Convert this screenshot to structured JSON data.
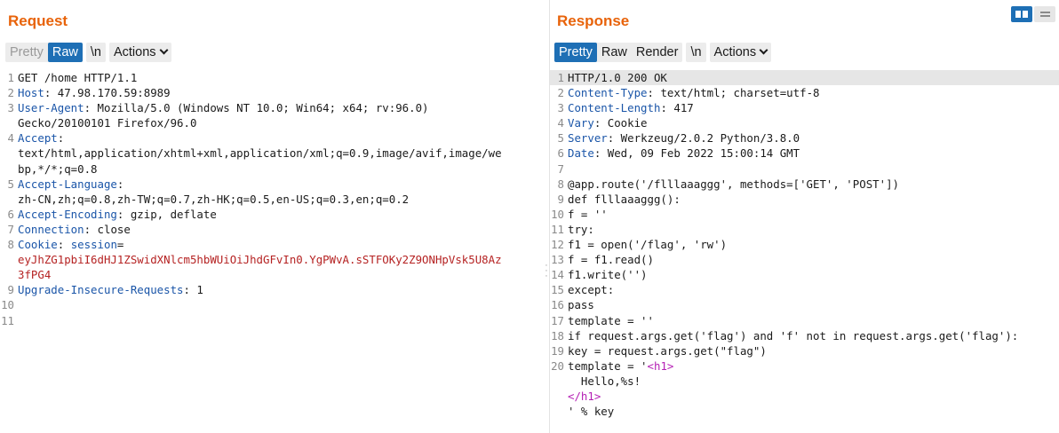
{
  "request": {
    "title": "Request",
    "toolbar": {
      "pretty": "Pretty",
      "raw": "Raw",
      "newline": "\\n",
      "actions": "Actions"
    },
    "lines": [
      {
        "n": "1",
        "parts": [
          {
            "t": "GET /home HTTP/1.1",
            "c": ""
          }
        ]
      },
      {
        "n": "2",
        "parts": [
          {
            "t": "Host",
            "c": "k"
          },
          {
            "t": ": 47.98.170.59:8989",
            "c": ""
          }
        ]
      },
      {
        "n": "3",
        "parts": [
          {
            "t": "User-Agent",
            "c": "k"
          },
          {
            "t": ": Mozilla/5.0 (Windows NT 10.0; Win64; x64; rv:96.0)",
            "c": ""
          }
        ]
      },
      {
        "n": "",
        "parts": [
          {
            "t": "Gecko/20100101 Firefox/96.0",
            "c": ""
          }
        ]
      },
      {
        "n": "4",
        "parts": [
          {
            "t": "Accept",
            "c": "k"
          },
          {
            "t": ":",
            "c": ""
          }
        ]
      },
      {
        "n": "",
        "parts": [
          {
            "t": "text/html,application/xhtml+xml,application/xml;q=0.9,image/avif,image/we",
            "c": ""
          }
        ]
      },
      {
        "n": "",
        "parts": [
          {
            "t": "bp,*/*;q=0.8",
            "c": ""
          }
        ]
      },
      {
        "n": "5",
        "parts": [
          {
            "t": "Accept-Language",
            "c": "k"
          },
          {
            "t": ":",
            "c": ""
          }
        ]
      },
      {
        "n": "",
        "parts": [
          {
            "t": "zh-CN,zh;q=0.8,zh-TW;q=0.7,zh-HK;q=0.5,en-US;q=0.3,en;q=0.2",
            "c": ""
          }
        ]
      },
      {
        "n": "6",
        "parts": [
          {
            "t": "Accept-Encoding",
            "c": "k"
          },
          {
            "t": ": gzip, deflate",
            "c": ""
          }
        ]
      },
      {
        "n": "7",
        "parts": [
          {
            "t": "Connection",
            "c": "k"
          },
          {
            "t": ": close",
            "c": ""
          }
        ]
      },
      {
        "n": "8",
        "parts": [
          {
            "t": "Cookie",
            "c": "k"
          },
          {
            "t": ": ",
            "c": ""
          },
          {
            "t": "session",
            "c": "k"
          },
          {
            "t": "=",
            "c": ""
          }
        ]
      },
      {
        "n": "",
        "parts": [
          {
            "t": "eyJhZG1pbiI6dHJ1ZSwidXNlcm5hbWUiOiJhdGFvIn0.YgPWvA.sSTFOKy2Z9ONHpVsk5U8Az",
            "c": "red"
          }
        ]
      },
      {
        "n": "",
        "parts": [
          {
            "t": "3fPG4",
            "c": "red"
          }
        ]
      },
      {
        "n": "9",
        "parts": [
          {
            "t": "Upgrade-Insecure-Requests",
            "c": "k"
          },
          {
            "t": ": 1",
            "c": ""
          }
        ]
      },
      {
        "n": "10",
        "parts": [
          {
            "t": "",
            "c": ""
          }
        ]
      },
      {
        "n": "11",
        "parts": [
          {
            "t": "",
            "c": ""
          }
        ]
      }
    ]
  },
  "response": {
    "title": "Response",
    "toolbar": {
      "pretty": "Pretty",
      "raw": "Raw",
      "render": "Render",
      "newline": "\\n",
      "actions": "Actions"
    },
    "lines": [
      {
        "n": "1",
        "hl": true,
        "parts": [
          {
            "t": "HTTP/1.0 200 OK",
            "c": ""
          }
        ]
      },
      {
        "n": "2",
        "parts": [
          {
            "t": "Content-Type",
            "c": "k"
          },
          {
            "t": ": text/html; charset=utf-8",
            "c": ""
          }
        ]
      },
      {
        "n": "3",
        "parts": [
          {
            "t": "Content-Length",
            "c": "k"
          },
          {
            "t": ": 417",
            "c": ""
          }
        ]
      },
      {
        "n": "4",
        "parts": [
          {
            "t": "Vary",
            "c": "k"
          },
          {
            "t": ": Cookie",
            "c": ""
          }
        ]
      },
      {
        "n": "5",
        "parts": [
          {
            "t": "Server",
            "c": "k"
          },
          {
            "t": ": Werkzeug/2.0.2 Python/3.8.0",
            "c": ""
          }
        ]
      },
      {
        "n": "6",
        "parts": [
          {
            "t": "Date",
            "c": "k"
          },
          {
            "t": ": Wed, 09 Feb 2022 15:00:14 GMT",
            "c": ""
          }
        ]
      },
      {
        "n": "7",
        "parts": [
          {
            "t": "",
            "c": ""
          }
        ]
      },
      {
        "n": "8",
        "parts": [
          {
            "t": "@app.route('/flllaaaggg', methods=['GET', 'POST'])",
            "c": ""
          }
        ]
      },
      {
        "n": "9",
        "parts": [
          {
            "t": "def flllaaaggg():",
            "c": ""
          }
        ]
      },
      {
        "n": "10",
        "parts": [
          {
            "t": "f = ''",
            "c": ""
          }
        ]
      },
      {
        "n": "11",
        "parts": [
          {
            "t": "try:",
            "c": ""
          }
        ]
      },
      {
        "n": "12",
        "parts": [
          {
            "t": "f1 = open('/flag', 'rw')",
            "c": ""
          }
        ]
      },
      {
        "n": "13",
        "parts": [
          {
            "t": "f = f1.read()",
            "c": ""
          }
        ]
      },
      {
        "n": "14",
        "parts": [
          {
            "t": "f1.write('')",
            "c": ""
          }
        ]
      },
      {
        "n": "15",
        "parts": [
          {
            "t": "except:",
            "c": ""
          }
        ]
      },
      {
        "n": "16",
        "parts": [
          {
            "t": "pass",
            "c": ""
          }
        ]
      },
      {
        "n": "17",
        "parts": [
          {
            "t": "template = ''",
            "c": ""
          }
        ]
      },
      {
        "n": "18",
        "parts": [
          {
            "t": "if request.args.get('flag') and 'f' not in request.args.get('flag'):",
            "c": ""
          }
        ]
      },
      {
        "n": "19",
        "parts": [
          {
            "t": "key = request.args.get(\"flag\")",
            "c": ""
          }
        ]
      },
      {
        "n": "20",
        "parts": [
          {
            "t": "template = '",
            "c": ""
          },
          {
            "t": "<h1>",
            "c": "tag"
          }
        ]
      },
      {
        "n": "",
        "parts": [
          {
            "t": "  Hello,%s!",
            "c": ""
          }
        ]
      },
      {
        "n": "",
        "parts": [
          {
            "t": "</h1>",
            "c": "tag"
          }
        ]
      },
      {
        "n": "",
        "parts": [
          {
            "t": "' % key",
            "c": ""
          }
        ]
      }
    ]
  },
  "colors": {
    "accent": "#1e6fb5",
    "title": "#e8630a",
    "header_key": "#1a55a8",
    "cookie_value": "#b52222",
    "html_tag": "#b41fb4"
  },
  "icons": {
    "layout_columns": "columns-layout-icon",
    "layout_rows": "rows-layout-icon",
    "divider": "drag-handle-icon"
  }
}
